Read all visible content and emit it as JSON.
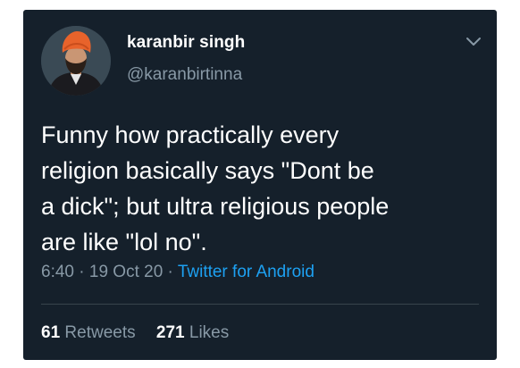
{
  "user": {
    "display_name": "karanbir singh",
    "handle": "@karanbirtinna"
  },
  "tweet": {
    "text": "Funny how practically every\nreligion basically says \"Dont be\na dick\"; but ultra religious people\nare like \"lol no\".",
    "time": "6:40",
    "date": "19 Oct 20",
    "source": "Twitter for Android",
    "separator": "·"
  },
  "stats": {
    "retweets_count": "61",
    "retweets_label": "Retweets",
    "likes_count": "271",
    "likes_label": "Likes"
  },
  "icons": {
    "menu": "chevron-down-icon"
  },
  "colors": {
    "background": "#15202b",
    "text": "#ffffff",
    "secondary": "#8899a6",
    "link": "#1da1f2",
    "divider": "#38444d"
  }
}
